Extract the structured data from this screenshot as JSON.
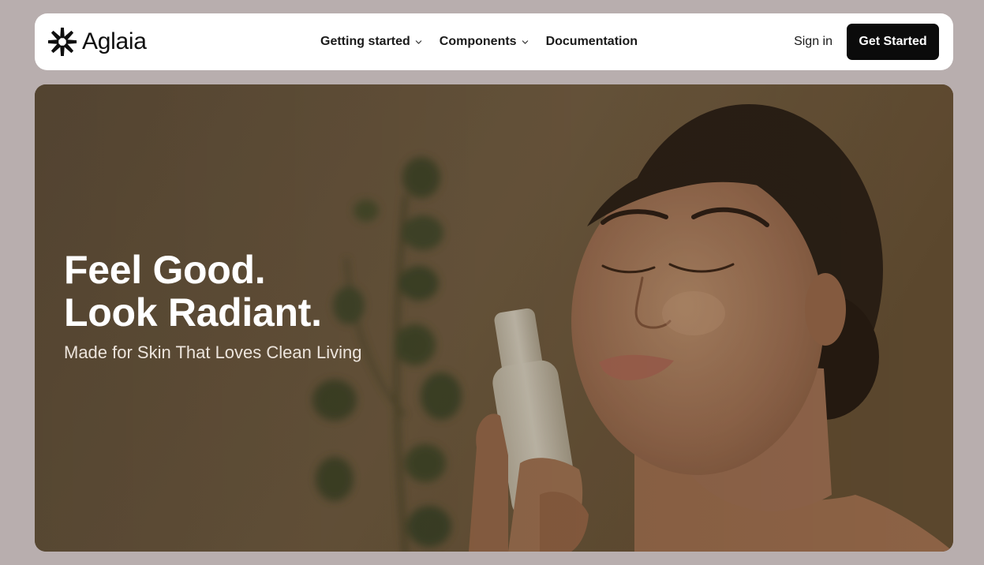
{
  "brand": {
    "name": "Aglaia",
    "logo_icon": "sparkle-burst-icon"
  },
  "nav": {
    "items": [
      {
        "label": "Getting started",
        "has_dropdown": true
      },
      {
        "label": "Components",
        "has_dropdown": true
      },
      {
        "label": "Documentation",
        "has_dropdown": false
      }
    ],
    "sign_in": "Sign in",
    "cta": "Get Started"
  },
  "hero": {
    "title_line1": "Feel Good.",
    "title_line2": "Look Radiant.",
    "subtitle": "Made for Skin That Loves Clean Living",
    "image_subject": "woman holding skincare bottle beside plant"
  },
  "colors": {
    "page_bg": "#b8aeae",
    "nav_bg": "#ffffff",
    "cta_bg": "#0b0b0b",
    "cta_text": "#ffffff",
    "hero_overlay": "#6e5c47"
  }
}
